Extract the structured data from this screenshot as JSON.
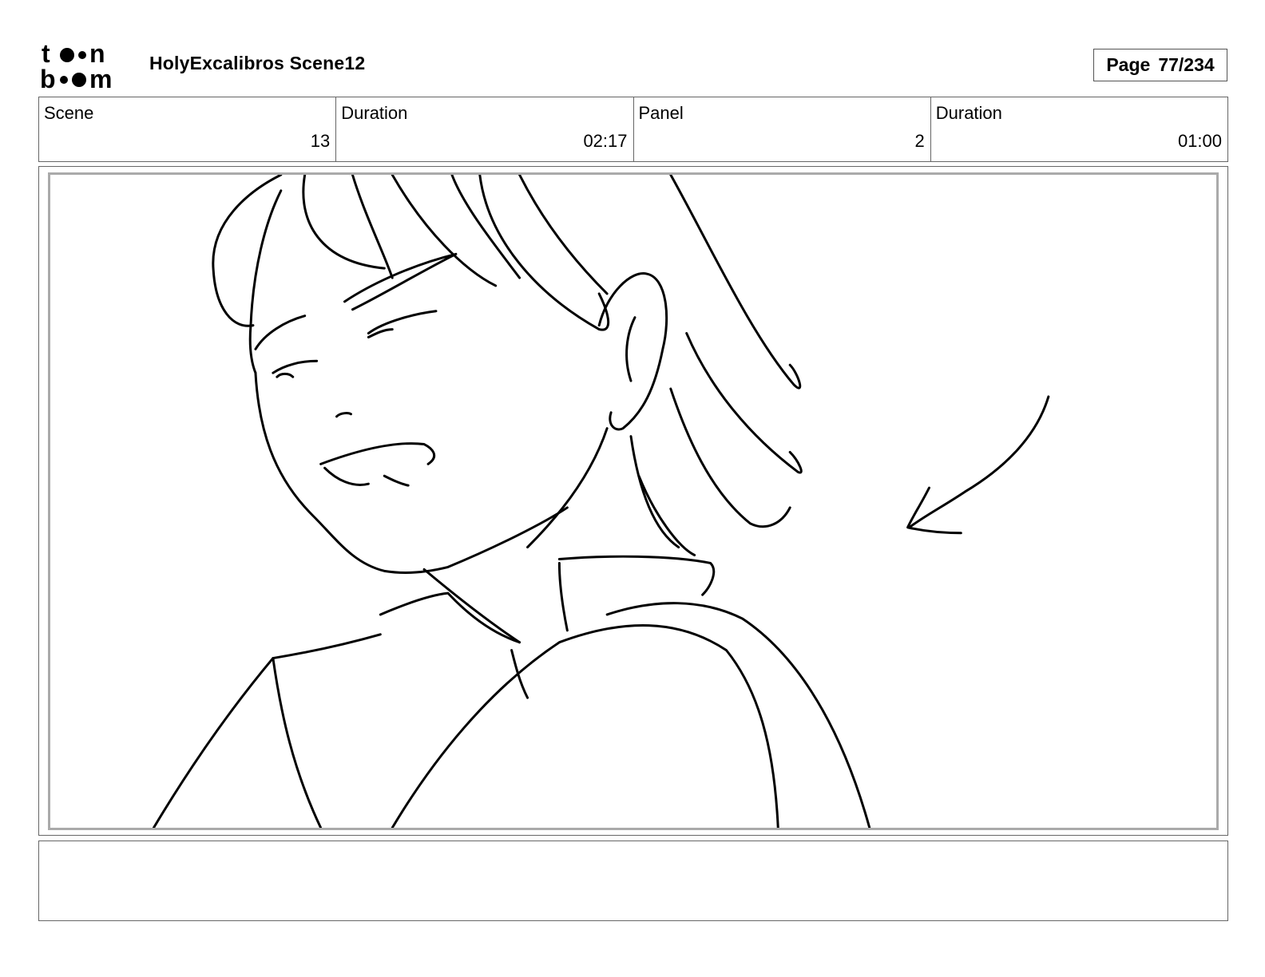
{
  "header": {
    "logo_top": "t••n",
    "logo_bottom": "b••m",
    "title": "HolyExcalibros Scene12",
    "page_label": "Page",
    "page_value": "77/234"
  },
  "info": {
    "scene_label": "Scene",
    "scene_value": "13",
    "scene_duration_label": "Duration",
    "scene_duration_value": "02:17",
    "panel_label": "Panel",
    "panel_value": "2",
    "panel_duration_label": "Duration",
    "panel_duration_value": "01:00"
  },
  "notes": {
    "text": ""
  }
}
